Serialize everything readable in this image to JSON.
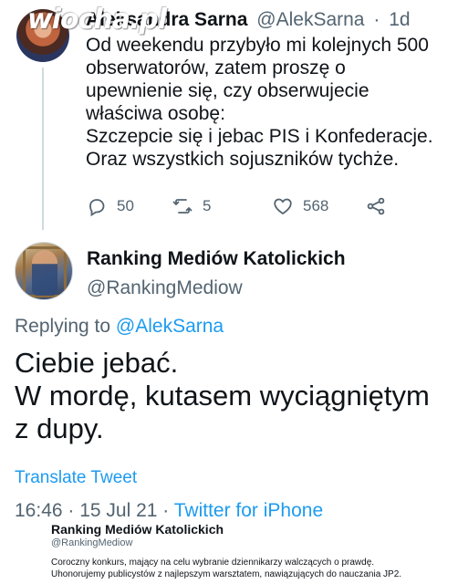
{
  "watermark": "wiocha.pl",
  "tweet1": {
    "display_name": "Aleksandra Sarna",
    "handle": "@AlekSarna",
    "separator": "·",
    "time": "1d",
    "text": "Od weekendu przybyło mi kolejnych 500\nobserwatorów, zatem proszę o\nupewnienie się, czy obserwujecie\nwłaściwa osobę:\nSzczepcie się i jebac PIS i Konfederacje.\nOraz wszystkich sojuszników tychże.",
    "reply_count": "50",
    "retweet_count": "5",
    "like_count": "568"
  },
  "tweet2": {
    "display_name": "Ranking Mediów Katolickich",
    "handle": "@RankingMediow",
    "replying_prefix": "Replying to",
    "replying_to": "@AlekSarna",
    "text": "Ciebie jebać.\nW mordę,  kutasem wyciągniętym\nz dupy.",
    "translate_label": "Translate Tweet",
    "timestamp": "16:46 · 15 Jul 21 · ",
    "client": "Twitter for iPhone"
  },
  "profile_card": {
    "name": "Ranking Mediów Katolickich",
    "handle": "@RankingMediow",
    "bio": "Coroczny konkurs, mający na celu wybranie dziennikarzy walczących o prawdę.\nUhonorujemy publicystów z najlepszym warsztatem, nawiązujących do nauczania JP2."
  },
  "icons": {
    "reply": "reply-icon",
    "retweet": "retweet-icon",
    "like": "heart-icon",
    "share": "share-icon"
  },
  "colors": {
    "link": "#1d9bf0",
    "secondary_text": "#536471",
    "primary_text": "#0f1419"
  }
}
